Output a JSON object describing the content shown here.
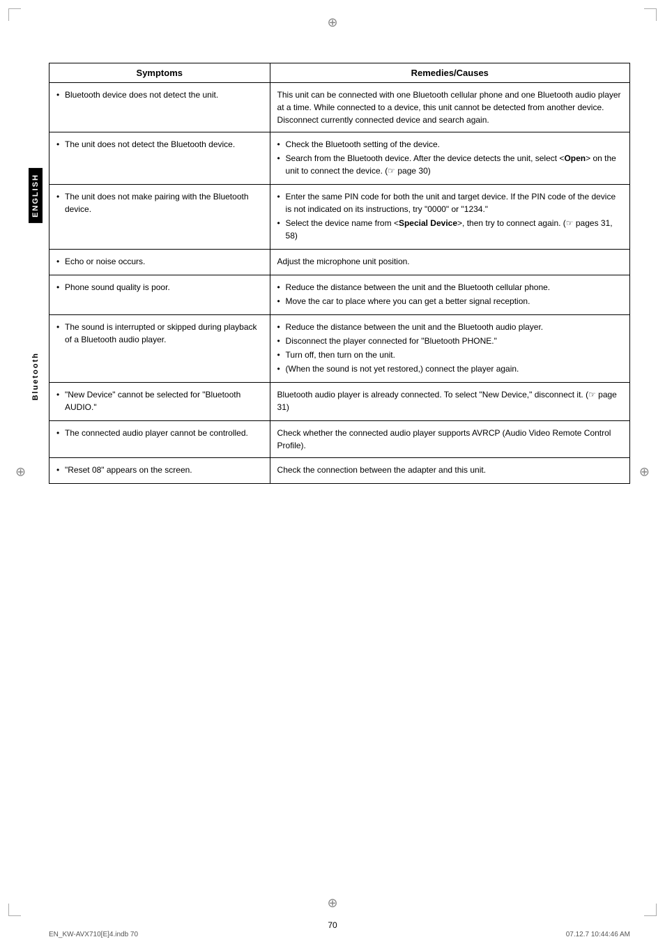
{
  "page": {
    "number": "70",
    "footer_left": "EN_KW-AVX710[E]4.indb  70",
    "footer_right": "07.12.7  10:44:46 AM"
  },
  "sidebar": {
    "english_label": "ENGLISH",
    "bluetooth_label": "Bluetooth"
  },
  "table": {
    "col_symptoms": "Symptoms",
    "col_remedies": "Remedies/Causes",
    "rows": [
      {
        "symptoms": [
          "Bluetooth device does not detect the unit."
        ],
        "remedies_text": "This unit can be connected with one Bluetooth cellular phone and one Bluetooth audio player at a time. While connected to a device, this unit cannot be detected from another device. Disconnect currently connected device and search again."
      },
      {
        "symptoms": [
          "The unit does not detect the Bluetooth device."
        ],
        "remedies": [
          "Check the Bluetooth setting of the device.",
          "Search from the Bluetooth device. After the device detects the unit, select <Open> on the unit to connect the device. (☞ page 30)"
        ]
      },
      {
        "symptoms": [
          "The unit does not make pairing with the Bluetooth device."
        ],
        "remedies": [
          "Enter the same PIN code for both the unit and target device. If the PIN code of the device is not indicated on its instructions, try \"0000\" or \"1234.\"",
          "Select the device name from <Special Device>, then try to connect again. (☞ pages 31, 58)"
        ]
      },
      {
        "symptoms": [
          "Echo or noise occurs."
        ],
        "remedies_text": "Adjust the microphone unit position."
      },
      {
        "symptoms": [
          "Phone sound quality is poor."
        ],
        "remedies": [
          "Reduce the distance between the unit and the Bluetooth cellular phone.",
          "Move the car to place where you can get a better signal reception."
        ]
      },
      {
        "symptoms": [
          "The sound is interrupted or skipped during playback of a Bluetooth audio player."
        ],
        "remedies": [
          "Reduce the distance between the unit and the Bluetooth audio player.",
          "Disconnect the player connected for \"Bluetooth PHONE.\"",
          "Turn off, then turn on the unit.",
          "(When the sound is not yet restored,) connect the player again."
        ]
      },
      {
        "symptoms": [
          "\"New Device\" cannot be selected for \"Bluetooth AUDIO.\""
        ],
        "remedies_text": "Bluetooth audio player is already connected. To select \"New Device,\" disconnect it. (☞ page 31)"
      },
      {
        "symptoms": [
          "The connected audio player cannot be controlled."
        ],
        "remedies_text": "Check whether the connected audio player supports AVRCP (Audio Video Remote Control Profile)."
      },
      {
        "symptoms": [
          "\"Reset 08\" appears on the screen."
        ],
        "remedies_text": "Check the connection between the adapter and this unit."
      }
    ]
  }
}
